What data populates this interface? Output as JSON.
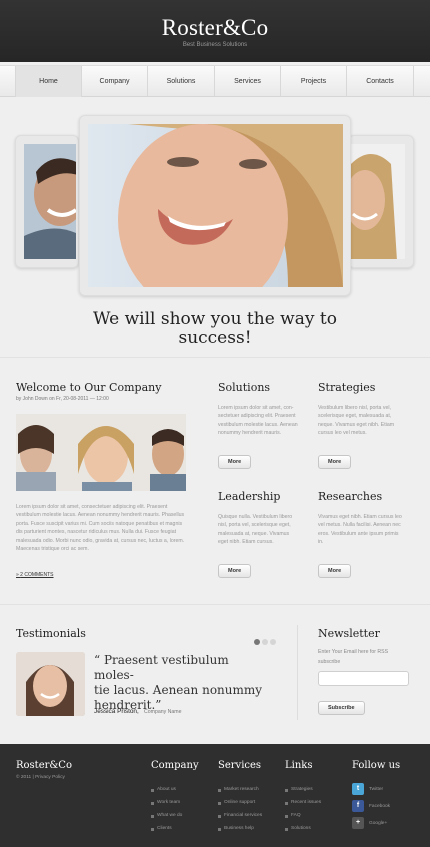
{
  "header": {
    "logo": "Roster&Co",
    "tagline": "Best Business Solutions"
  },
  "nav": {
    "items": [
      {
        "label": "Home",
        "active": true
      },
      {
        "label": "Company"
      },
      {
        "label": "Solutions"
      },
      {
        "label": "Services"
      },
      {
        "label": "Projects"
      },
      {
        "label": "Contacts"
      }
    ]
  },
  "hero": {
    "headline_line1": "We will show you the way to",
    "headline_line2": "success!"
  },
  "welcome": {
    "title": "Welcome to Our Company",
    "meta": "by John Down on Fr, 20-08-2011 — 12:00",
    "body": "Lorem ipsum dolor sit amet, consectetuer adipiscing elit. Praesent vestibulum molestie lacus. Aenean nonummy hendrerit mauris. Phasellus porta. Fusce suscipit varius mi. Cum sociis natoque penatibus et magnis dis parturient montes, nascetur ridiculus mus. Nulla dui. Fusce feugiat malesuada odio. Morbi nunc odio, gravida at, cursus nec, luctus a, lorem. Maecenas tristique orci ac sem.",
    "comments": "2 COMMENTS"
  },
  "solutions": {
    "title": "Solutions",
    "body": "Lorem ipsum dolor sit amet, con-sectetuer adipiscing elit. Praesent vestibulum molestie lacus. Aenean nonummy hendrerit mauris.",
    "button": "More"
  },
  "strategies": {
    "title": "Strategies",
    "body": "Vestibulum libero nisl, porta vel, scelerisque eget, malesuada at, neque. Vivamus eget nibh. Etiam cursus leo vel metus.",
    "button": "More"
  },
  "leadership": {
    "title": "Leadership",
    "body": "Quisque nulla. Vestibulum libero nisl, porta vel, scelerisque eget, malesuada at, neque. Vivamus eget nibh. Etiam cursus.",
    "button": "More"
  },
  "researches": {
    "title": "Researches",
    "body": "Vivamus eget nibh. Etiam cursus leo vel metus. Nulla facilisi. Aenean nec eros. Vestibulum ante ipsum primis in.",
    "button": "More"
  },
  "testimonials": {
    "title": "Testimonials",
    "quote_l1": "“ Praesent vestibulum moles-",
    "quote_l2": "tie lacus. Aenean nonummy",
    "quote_l3": "hendrerit.”",
    "author": "Jessica Priston,",
    "company": "Company Name",
    "slides": 3,
    "active_slide": 1
  },
  "newsletter": {
    "title": "Newsletter",
    "label_l1": "Enter Your Email here for RSS",
    "label_l2": "subscribe",
    "button": "Subscribe"
  },
  "footer": {
    "logo": "Roster&Co",
    "copyright": "© 2011  |  Privacy Policy",
    "company": {
      "title": "Company",
      "links": [
        "About us",
        "Work team",
        "What we do",
        "Clients"
      ]
    },
    "services": {
      "title": "Services",
      "links": [
        "Market research",
        "Online support",
        "Financial services",
        "Business help"
      ]
    },
    "links": {
      "title": "Links",
      "links": [
        "Strategies",
        "Recent issues",
        "FAQ",
        "Solutions"
      ]
    },
    "follow": {
      "title": "Follow us",
      "items": [
        "Twitter",
        "Facebook",
        "Google+"
      ]
    }
  },
  "colors": {
    "header_bg": "#2d2d2d",
    "footer_bg": "#2f2f2f",
    "page_bg": "#efefef",
    "twitter": "#4aa6d6",
    "facebook": "#3b5998",
    "google": "#555555"
  }
}
